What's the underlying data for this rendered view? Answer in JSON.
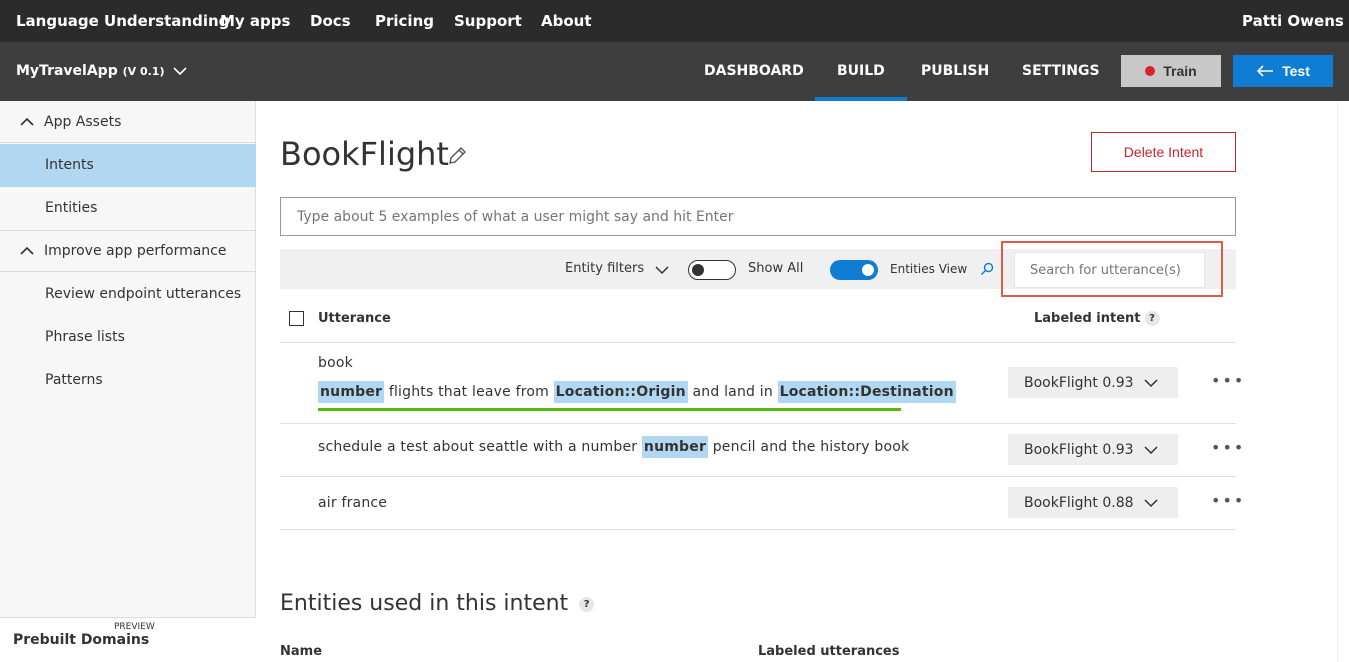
{
  "topnav": {
    "brand": "Language Understanding",
    "my_apps": "My apps",
    "docs": "Docs",
    "pricing": "Pricing",
    "support": "Support",
    "about": "About",
    "user": "Patti Owens"
  },
  "appbar": {
    "app_name": "MyTravelApp",
    "version": "(V 0.1)",
    "tabs": [
      "DASHBOARD",
      "BUILD",
      "PUBLISH",
      "SETTINGS"
    ],
    "active_tab": "BUILD",
    "train_label": "Train",
    "test_label": "Test"
  },
  "sidebar": {
    "app_assets": "App Assets",
    "intents": "Intents",
    "entities": "Entities",
    "improve": "Improve app performance",
    "review": "Review endpoint utterances",
    "phrase_lists": "Phrase lists",
    "patterns": "Patterns",
    "prebuilt": "Prebuilt Domains",
    "preview": "PREVIEW"
  },
  "main": {
    "intent_title": "BookFlight",
    "delete_label": "Delete Intent",
    "utterance_placeholder": "Type about 5 examples of what a user might say and hit Enter",
    "entity_filters": "Entity filters",
    "show_all": "Show All",
    "entities_view": "Entities View",
    "search_placeholder": "Search for utterance(s)",
    "col_utterance": "Utterance",
    "col_labeled_intent": "Labeled intent",
    "section_entities": "Entities used in this intent",
    "col_name": "Name",
    "col_labeled_utterances": "Labeled utterances"
  },
  "rows": [
    {
      "line1": "book",
      "e1": "number",
      "t1": "flights that leave from",
      "e2": "Location::Origin",
      "t2": "and land in",
      "e3": "Location::Destination",
      "intent": "BookFlight 0.93"
    },
    {
      "t1": "schedule a test about seattle with a number",
      "e1": "number",
      "t2": "pencil and the history book",
      "intent": "BookFlight 0.93"
    },
    {
      "t1": "air france",
      "intent": "BookFlight 0.88"
    }
  ],
  "colors": {
    "accent": "#0f7dd4",
    "danger": "#c4262e",
    "entity_highlight": "#b2d7f1",
    "label_underline": "#57b80f"
  }
}
